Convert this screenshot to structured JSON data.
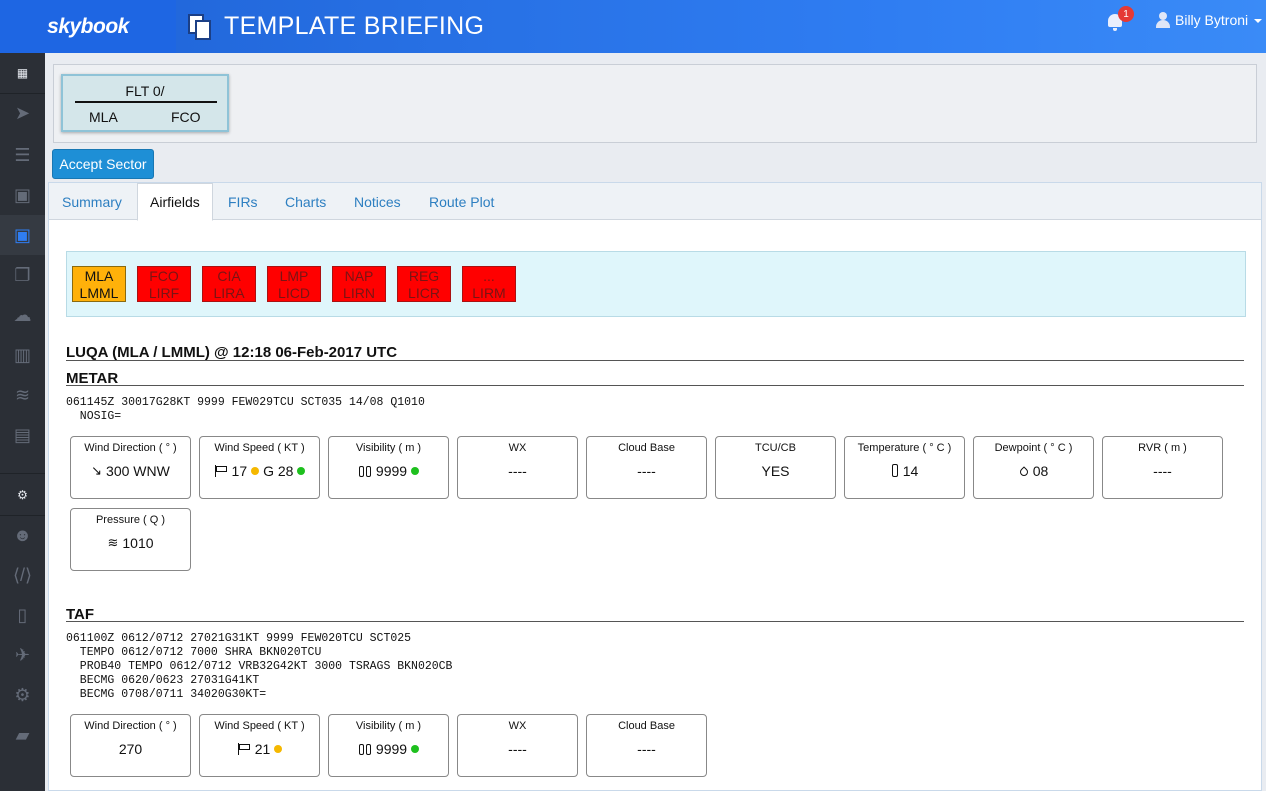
{
  "app": {
    "brand": "skybook",
    "page_title": "TEMPLATE BRIEFING",
    "notification_count": "1",
    "user_name": "Billy Bytroni"
  },
  "sidebar": {
    "items": [
      {
        "icon": "grid-icon"
      },
      {
        "icon": "paper-plane-icon"
      },
      {
        "icon": "list-icon"
      },
      {
        "icon": "briefcase-icon"
      },
      {
        "icon": "briefcase-icon",
        "active": true
      },
      {
        "icon": "documents-icon"
      },
      {
        "icon": "cloud-icon"
      },
      {
        "icon": "book-icon"
      },
      {
        "icon": "database-icon"
      },
      {
        "icon": "file-icon"
      },
      {
        "icon": "gear-icon"
      },
      {
        "icon": "users-icon"
      },
      {
        "icon": "code-icon"
      },
      {
        "icon": "mobile-icon"
      },
      {
        "icon": "plane-icon"
      },
      {
        "icon": "gears-icon"
      },
      {
        "icon": "folder-open-icon"
      }
    ]
  },
  "flight": {
    "title": "FLT 0/",
    "from": "MLA",
    "to": "FCO"
  },
  "actions": {
    "accept_sector": "Accept Sector"
  },
  "tabs": [
    {
      "label": "Summary"
    },
    {
      "label": "Airfields",
      "active": true
    },
    {
      "label": "FIRs"
    },
    {
      "label": "Charts"
    },
    {
      "label": "Notices"
    },
    {
      "label": "Route Plot"
    }
  ],
  "airfields": [
    {
      "iata": "MLA",
      "icao": "LMML",
      "status_color": "#ffb10a"
    },
    {
      "iata": "FCO",
      "icao": "LIRF",
      "status_color": "#ff0000"
    },
    {
      "iata": "CIA",
      "icao": "LIRA",
      "status_color": "#ff0000"
    },
    {
      "iata": "LMP",
      "icao": "LICD",
      "status_color": "#ff0000"
    },
    {
      "iata": "NAP",
      "icao": "LIRN",
      "status_color": "#ff0000"
    },
    {
      "iata": "REG",
      "icao": "LICR",
      "status_color": "#ff0000"
    },
    {
      "iata": "...",
      "icao": "LIRM",
      "status_color": "#ff0000"
    }
  ],
  "station": {
    "heading": "LUQA (MLA / LMML) @ 12:18 06-Feb-2017 UTC"
  },
  "metar": {
    "heading": "METAR",
    "raw_lines": [
      "061145Z 30017G28KT 9999 FEW029TCU SCT035 14/08 Q1010",
      "  NOSIG="
    ],
    "cards": {
      "wind_dir": {
        "label": "Wind Direction ( ° )",
        "value": "300 WNW"
      },
      "wind_speed": {
        "label": "Wind Speed ( KT )",
        "value": "17",
        "gust_label": "G 28"
      },
      "visibility": {
        "label": "Visibility ( m )",
        "value": "9999"
      },
      "wx": {
        "label": "WX",
        "value": "----"
      },
      "cloud_base": {
        "label": "Cloud Base",
        "value": "----"
      },
      "tcu_cb": {
        "label": "TCU/CB",
        "value": "YES"
      },
      "temperature": {
        "label": "Temperature ( ° C )",
        "value": "14"
      },
      "dewpoint": {
        "label": "Dewpoint ( ° C )",
        "value": "08"
      },
      "rvr": {
        "label": "RVR ( m )",
        "value": "----"
      },
      "pressure": {
        "label": "Pressure ( Q )",
        "value": "1010"
      }
    }
  },
  "taf": {
    "heading": "TAF",
    "raw_lines": [
      "061100Z 0612/0712 27021G31KT 9999 FEW020TCU SCT025",
      "  TEMPO 0612/0712 7000 SHRA BKN020TCU",
      "  PROB40 TEMPO 0612/0712 VRB32G42KT 3000 TSRAGS BKN020CB",
      "  BECMG 0620/0623 27031G41KT",
      "  BECMG 0708/0711 34020G30KT="
    ],
    "cards": {
      "wind_dir": {
        "label": "Wind Direction ( ° )",
        "value": "270"
      },
      "wind_speed": {
        "label": "Wind Speed ( KT )",
        "value": "21"
      },
      "visibility": {
        "label": "Visibility ( m )",
        "value": "9999"
      },
      "wx": {
        "label": "WX",
        "value": "----"
      },
      "cloud_base": {
        "label": "Cloud Base",
        "value": "----"
      }
    }
  }
}
